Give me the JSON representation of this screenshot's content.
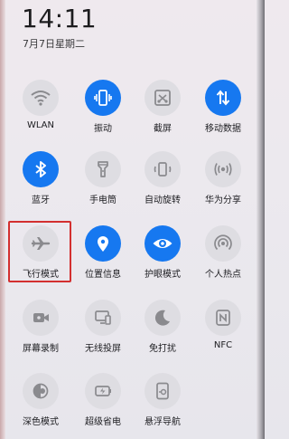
{
  "status": {
    "time": "14:11",
    "date": "7月7日星期二"
  },
  "tiles": [
    {
      "label": "WLAN",
      "icon": "wifi-icon",
      "on": false
    },
    {
      "label": "振动",
      "icon": "vibrate-icon",
      "on": true
    },
    {
      "label": "截屏",
      "icon": "screenshot-icon",
      "on": false
    },
    {
      "label": "移动数据",
      "icon": "mobile-data-icon",
      "on": true
    },
    {
      "label": "蓝牙",
      "icon": "bluetooth-icon",
      "on": true
    },
    {
      "label": "手电筒",
      "icon": "flashlight-icon",
      "on": false
    },
    {
      "label": "自动旋转",
      "icon": "auto-rotate-icon",
      "on": false
    },
    {
      "label": "华为分享",
      "icon": "huawei-share-icon",
      "on": false
    },
    {
      "label": "飞行模式",
      "icon": "airplane-icon",
      "on": false
    },
    {
      "label": "位置信息",
      "icon": "location-icon",
      "on": true
    },
    {
      "label": "护眼模式",
      "icon": "eye-icon",
      "on": true
    },
    {
      "label": "个人热点",
      "icon": "hotspot-icon",
      "on": false
    },
    {
      "label": "屏幕录制",
      "icon": "screen-record-icon",
      "on": false
    },
    {
      "label": "无线投屏",
      "icon": "wireless-projection-icon",
      "on": false
    },
    {
      "label": "免打扰",
      "icon": "moon-icon",
      "on": false
    },
    {
      "label": "NFC",
      "icon": "nfc-icon",
      "on": false
    },
    {
      "label": "深色模式",
      "icon": "dark-mode-icon",
      "on": false
    },
    {
      "label": "超级省电",
      "icon": "battery-saver-icon",
      "on": false
    },
    {
      "label": "悬浮导航",
      "icon": "floating-nav-icon",
      "on": false
    }
  ],
  "colors": {
    "active": "#1678f0",
    "inactive": "#dedde2",
    "highlight": "#d32f2f"
  }
}
